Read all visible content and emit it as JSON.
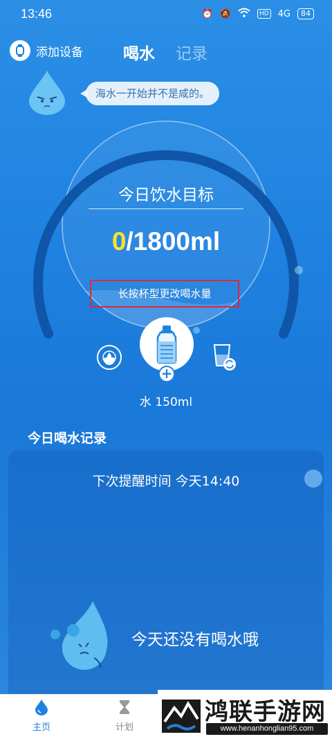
{
  "status_bar": {
    "time": "13:46",
    "hd_label": "HD",
    "signal_label": "4G",
    "battery": "84"
  },
  "header": {
    "add_device_label": "添加设备",
    "tabs": [
      {
        "label": "喝水",
        "active": true
      },
      {
        "label": "记录",
        "active": false
      }
    ]
  },
  "tip": {
    "text": "海水一开始并不是咸的。"
  },
  "goal": {
    "title": "今日饮水目标",
    "current": "0",
    "target": "/1800ml",
    "progress": 0,
    "hint": "长按杯型更改喝水量"
  },
  "cup": {
    "label": "水 150ml"
  },
  "records": {
    "title": "今日喝水记录",
    "next_reminder": "下次提醒时间 今天14:40",
    "empty_text": "今天还没有喝水哦"
  },
  "bottom_nav": {
    "items": [
      {
        "label": "主页",
        "active": true
      },
      {
        "label": "计划",
        "active": false
      }
    ]
  },
  "watermark": {
    "title": "鸿联手游网",
    "url": "www.henanhonglian95.com"
  },
  "colors": {
    "accent": "#1f82e0",
    "highlight_value": "#ffe22b",
    "hint_border": "#e0273a"
  }
}
